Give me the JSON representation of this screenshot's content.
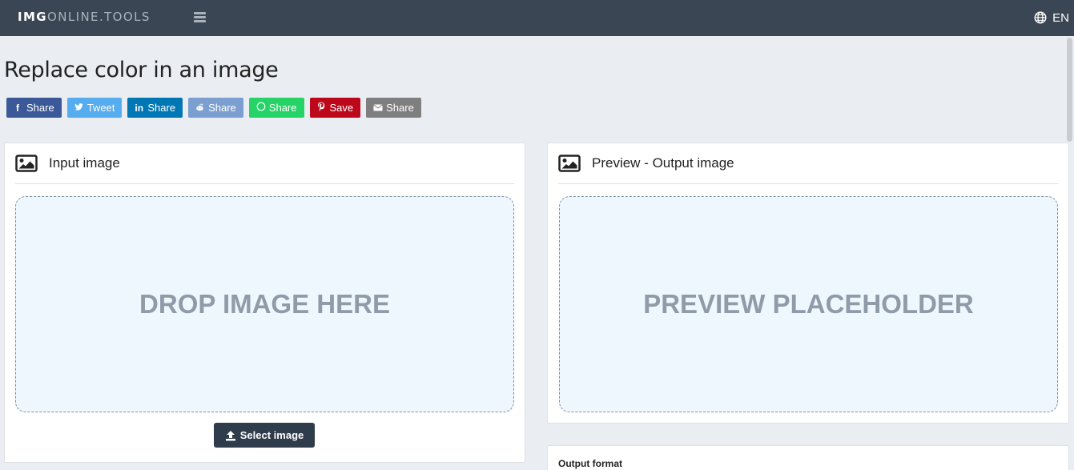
{
  "header": {
    "logo_part1": "IMG",
    "logo_part2": "ONLINE.TOOLS",
    "language": "EN"
  },
  "page": {
    "title": "Replace color in an image"
  },
  "share_buttons": [
    {
      "label": "Share",
      "icon": "facebook-icon",
      "color": "#3b5998"
    },
    {
      "label": "Tweet",
      "icon": "twitter-icon",
      "color": "#55acee"
    },
    {
      "label": "Share",
      "icon": "linkedin-icon",
      "color": "#0077b5"
    },
    {
      "label": "Share",
      "icon": "reddit-icon",
      "color": "#7a9fd0"
    },
    {
      "label": "Share",
      "icon": "whatsapp-icon",
      "color": "#25d366"
    },
    {
      "label": "Save",
      "icon": "pinterest-icon",
      "color": "#bd081c"
    },
    {
      "label": "Share",
      "icon": "email-icon",
      "color": "#7f7f7f"
    }
  ],
  "input_card": {
    "title": "Input image",
    "dropzone_text": "DROP IMAGE HERE",
    "select_button": "Select image"
  },
  "output_card": {
    "title": "Preview - Output image",
    "placeholder_text": "PREVIEW PLACEHOLDER"
  },
  "options_card": {
    "output_format_label": "Output format"
  },
  "colors": {
    "topbar": "#3a4653",
    "background": "#eaedf1",
    "dropzone_bg": "#eef6fe",
    "button_dark": "#2f3c4b"
  }
}
